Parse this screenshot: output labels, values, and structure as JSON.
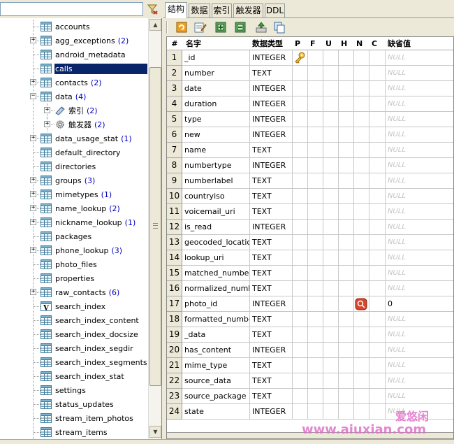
{
  "tree": {
    "items": [
      {
        "label": "accounts",
        "count": "",
        "expandable": false,
        "level": 1
      },
      {
        "label": "agg_exceptions",
        "count": "(2)",
        "expandable": true,
        "level": 1
      },
      {
        "label": "android_metadata",
        "count": "",
        "expandable": false,
        "level": 1
      },
      {
        "label": "calls",
        "count": "",
        "expandable": false,
        "level": 1,
        "selected": true
      },
      {
        "label": "contacts",
        "count": "(2)",
        "expandable": true,
        "level": 1
      },
      {
        "label": "data",
        "count": "(4)",
        "expandable": true,
        "expanded": true,
        "level": 1
      },
      {
        "label": "索引",
        "count": "(2)",
        "expandable": true,
        "level": 2,
        "icon": "index-icon"
      },
      {
        "label": "触发器",
        "count": "(2)",
        "expandable": true,
        "level": 2,
        "icon": "trigger-icon"
      },
      {
        "label": "data_usage_stat",
        "count": "(1)",
        "expandable": true,
        "level": 1
      },
      {
        "label": "default_directory",
        "count": "",
        "expandable": false,
        "level": 1
      },
      {
        "label": "directories",
        "count": "",
        "expandable": false,
        "level": 1
      },
      {
        "label": "groups",
        "count": "(3)",
        "expandable": true,
        "level": 1
      },
      {
        "label": "mimetypes",
        "count": "(1)",
        "expandable": true,
        "level": 1
      },
      {
        "label": "name_lookup",
        "count": "(2)",
        "expandable": true,
        "level": 1
      },
      {
        "label": "nickname_lookup",
        "count": "(1)",
        "expandable": true,
        "level": 1
      },
      {
        "label": "packages",
        "count": "",
        "expandable": false,
        "level": 1
      },
      {
        "label": "phone_lookup",
        "count": "(3)",
        "expandable": true,
        "level": 1
      },
      {
        "label": "photo_files",
        "count": "",
        "expandable": false,
        "level": 1
      },
      {
        "label": "properties",
        "count": "",
        "expandable": false,
        "level": 1
      },
      {
        "label": "raw_contacts",
        "count": "(6)",
        "expandable": true,
        "level": 1
      },
      {
        "label": "search_index",
        "count": "",
        "expandable": false,
        "level": 1,
        "icon": "virtual-table-icon"
      },
      {
        "label": "search_index_content",
        "count": "",
        "expandable": false,
        "level": 1
      },
      {
        "label": "search_index_docsize",
        "count": "",
        "expandable": false,
        "level": 1
      },
      {
        "label": "search_index_segdir",
        "count": "",
        "expandable": false,
        "level": 1
      },
      {
        "label": "search_index_segments",
        "count": "",
        "expandable": false,
        "level": 1
      },
      {
        "label": "search_index_stat",
        "count": "",
        "expandable": false,
        "level": 1
      },
      {
        "label": "settings",
        "count": "",
        "expandable": false,
        "level": 1
      },
      {
        "label": "status_updates",
        "count": "",
        "expandable": false,
        "level": 1
      },
      {
        "label": "stream_item_photos",
        "count": "",
        "expandable": false,
        "level": 1
      },
      {
        "label": "stream_items",
        "count": "",
        "expandable": false,
        "level": 1
      }
    ]
  },
  "tabs": [
    {
      "label": "结构",
      "active": true
    },
    {
      "label": "数据",
      "active": false
    },
    {
      "label": "索引",
      "active": false
    },
    {
      "label": "触发器",
      "active": false
    },
    {
      "label": "DDL",
      "active": false
    }
  ],
  "toolbar": {
    "buttons": [
      "refresh-icon",
      "edit-icon",
      "add-column-icon",
      "insert-column-icon",
      "move-icon",
      "copy-icon"
    ]
  },
  "grid": {
    "headers": {
      "num": "#",
      "name": "名字",
      "type": "数据类型",
      "p": "P",
      "f": "F",
      "u": "U",
      "h": "H",
      "n": "N",
      "c": "C",
      "default": "缺省值"
    },
    "null_text": "NULL",
    "rows": [
      {
        "num": "1",
        "name": "_id",
        "type": "INTEGER",
        "pk": true,
        "default": ""
      },
      {
        "num": "2",
        "name": "number",
        "type": "TEXT",
        "default": ""
      },
      {
        "num": "3",
        "name": "date",
        "type": "INTEGER",
        "default": ""
      },
      {
        "num": "4",
        "name": "duration",
        "type": "INTEGER",
        "default": ""
      },
      {
        "num": "5",
        "name": "type",
        "type": "INTEGER",
        "default": ""
      },
      {
        "num": "6",
        "name": "new",
        "type": "INTEGER",
        "default": ""
      },
      {
        "num": "7",
        "name": "name",
        "type": "TEXT",
        "default": ""
      },
      {
        "num": "8",
        "name": "numbertype",
        "type": "INTEGER",
        "default": ""
      },
      {
        "num": "9",
        "name": "numberlabel",
        "type": "TEXT",
        "default": ""
      },
      {
        "num": "10",
        "name": "countryiso",
        "type": "TEXT",
        "default": ""
      },
      {
        "num": "11",
        "name": "voicemail_uri",
        "type": "TEXT",
        "default": ""
      },
      {
        "num": "12",
        "name": "is_read",
        "type": "INTEGER",
        "default": ""
      },
      {
        "num": "13",
        "name": "geocoded_location",
        "type": "TEXT",
        "default": ""
      },
      {
        "num": "14",
        "name": "lookup_uri",
        "type": "TEXT",
        "default": ""
      },
      {
        "num": "15",
        "name": "matched_number",
        "type": "TEXT",
        "default": ""
      },
      {
        "num": "16",
        "name": "normalized_number",
        "type": "TEXT",
        "default": ""
      },
      {
        "num": "17",
        "name": "photo_id",
        "type": "INTEGER",
        "notnull": true,
        "default": "0"
      },
      {
        "num": "18",
        "name": "formatted_number",
        "type": "TEXT",
        "default": ""
      },
      {
        "num": "19",
        "name": "_data",
        "type": "TEXT",
        "default": ""
      },
      {
        "num": "20",
        "name": "has_content",
        "type": "INTEGER",
        "default": ""
      },
      {
        "num": "21",
        "name": "mime_type",
        "type": "TEXT",
        "default": ""
      },
      {
        "num": "22",
        "name": "source_data",
        "type": "TEXT",
        "default": ""
      },
      {
        "num": "23",
        "name": "source_package",
        "type": "TEXT",
        "default": ""
      },
      {
        "num": "24",
        "name": "state",
        "type": "INTEGER",
        "default": ""
      }
    ]
  },
  "watermark": {
    "text": "www.aiuxian.com",
    "cn": "爱悠闲"
  },
  "colors": {
    "selection": "#0a246a",
    "count": "#0000c0",
    "watermark": "#e070c8"
  }
}
